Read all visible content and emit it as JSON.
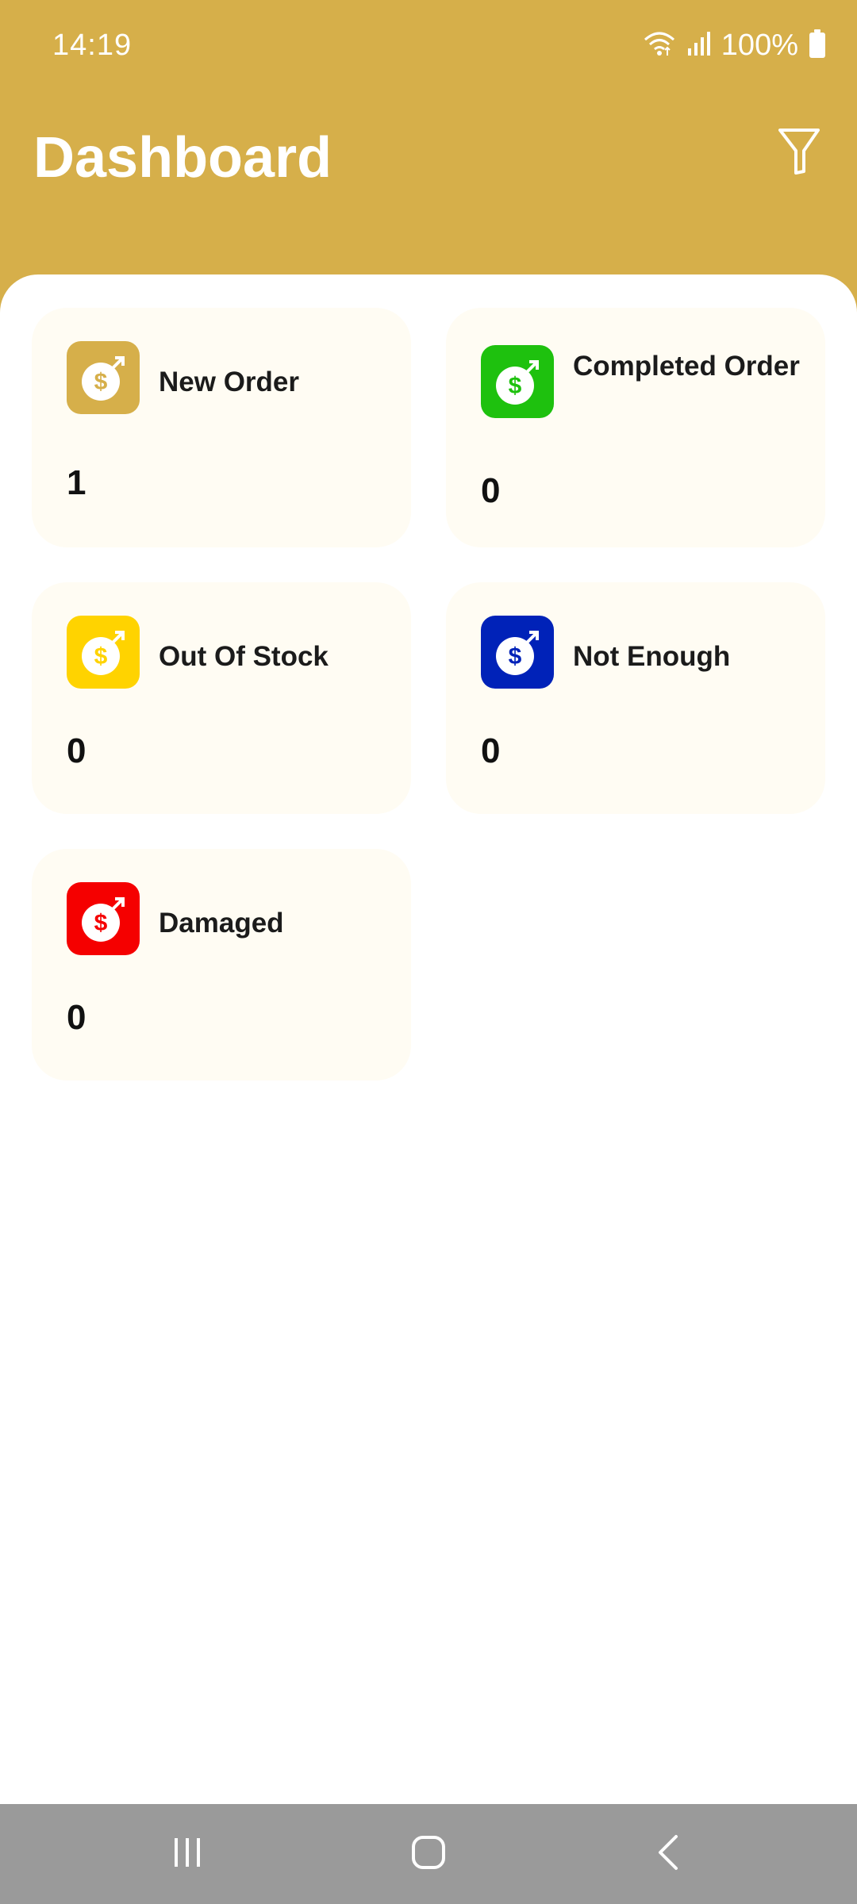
{
  "status_bar": {
    "time": "14:19",
    "battery_text": "100%",
    "icons": [
      "wifi-icon",
      "signal-icon",
      "battery-icon"
    ]
  },
  "header": {
    "title": "Dashboard",
    "filter_icon": "filter-icon",
    "background_color": "#D6AF4A"
  },
  "cards": [
    {
      "id": "new-order",
      "label": "New Order",
      "value": "1",
      "icon_color": "#D6AF4A",
      "icon": "money-bag-icon"
    },
    {
      "id": "completed-order",
      "label": "Completed Order",
      "value": "0",
      "icon_color": "#1EC10E",
      "icon": "money-bag-icon"
    },
    {
      "id": "out-of-stock",
      "label": "Out Of Stock",
      "value": "0",
      "icon_color": "#FFD300",
      "icon": "money-bag-icon"
    },
    {
      "id": "not-enough",
      "label": "Not Enough",
      "value": "0",
      "icon_color": "#0022B8",
      "icon": "money-bag-icon"
    },
    {
      "id": "damaged",
      "label": "Damaged",
      "value": "0",
      "icon_color": "#F50000",
      "icon": "money-bag-icon"
    }
  ],
  "nav_bar": {
    "buttons": [
      "recent-apps-icon",
      "home-icon",
      "back-icon"
    ]
  }
}
